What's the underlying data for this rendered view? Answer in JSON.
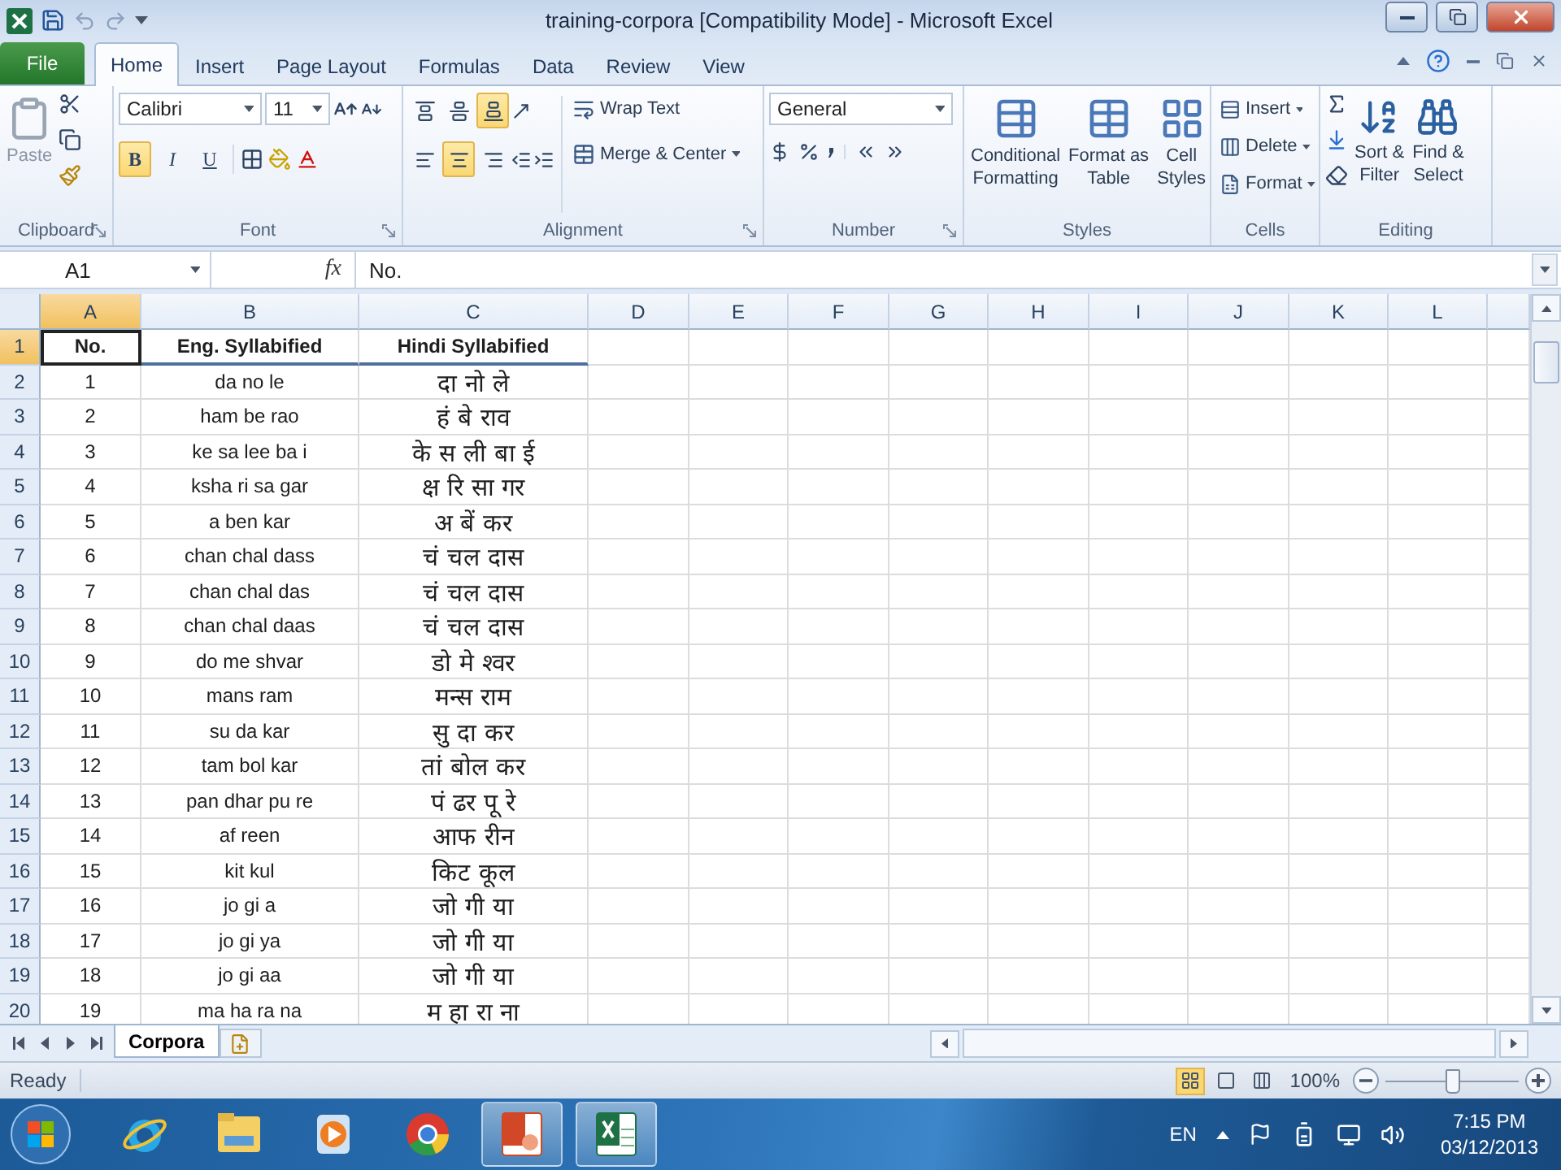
{
  "window": {
    "title": "training-corpora  [Compatibility Mode] - Microsoft Excel"
  },
  "ribbon_tabs": [
    {
      "label": "File",
      "kind": "file",
      "selected": false
    },
    {
      "label": "Home",
      "kind": "tab",
      "selected": true
    },
    {
      "label": "Insert",
      "kind": "tab",
      "selected": false
    },
    {
      "label": "Page Layout",
      "kind": "tab",
      "selected": false
    },
    {
      "label": "Formulas",
      "kind": "tab",
      "selected": false
    },
    {
      "label": "Data",
      "kind": "tab",
      "selected": false
    },
    {
      "label": "Review",
      "kind": "tab",
      "selected": false
    },
    {
      "label": "View",
      "kind": "tab",
      "selected": false
    }
  ],
  "clipboard": {
    "label": "Clipboard",
    "paste": "Paste"
  },
  "font": {
    "label": "Font",
    "name": "Calibri",
    "size": "11",
    "styles": [
      {
        "label": "B",
        "selected": true
      },
      {
        "label": "I",
        "selected": false
      },
      {
        "label": "U",
        "selected": false
      }
    ]
  },
  "alignment": {
    "label": "Alignment",
    "vertical": [
      {
        "selected": false
      },
      {
        "selected": false
      },
      {
        "selected": true
      }
    ],
    "horizontal": [
      {
        "selected": false
      },
      {
        "selected": true
      },
      {
        "selected": false
      }
    ],
    "wrap_text": "Wrap Text",
    "merge": "Merge & Center"
  },
  "number": {
    "label": "Number",
    "format": "General"
  },
  "styles": {
    "label": "Styles",
    "buttons": [
      {
        "lines": [
          "Conditional",
          "Formatting"
        ]
      },
      {
        "lines": [
          "Format as",
          "Table"
        ]
      },
      {
        "lines": [
          "Cell",
          "Styles"
        ]
      }
    ]
  },
  "cells": {
    "label": "Cells",
    "buttons": [
      "Insert",
      "Delete",
      "Format"
    ]
  },
  "editing": {
    "label": "Editing",
    "buttons": [
      {
        "lines": [
          "Sort &",
          "Filter"
        ]
      },
      {
        "lines": [
          "Find &",
          "Select"
        ]
      }
    ]
  },
  "formula_bar": {
    "name_box": "A1",
    "function_label": "fx",
    "value": "No."
  },
  "grid": {
    "columns": [
      {
        "label": "A",
        "selected": true
      },
      {
        "label": "B",
        "selected": false
      },
      {
        "label": "C",
        "selected": false
      },
      {
        "label": "D",
        "selected": false
      },
      {
        "label": "E",
        "selected": false
      },
      {
        "label": "F",
        "selected": false
      },
      {
        "label": "G",
        "selected": false
      },
      {
        "label": "H",
        "selected": false
      },
      {
        "label": "I",
        "selected": false
      },
      {
        "label": "J",
        "selected": false
      },
      {
        "label": "K",
        "selected": false
      },
      {
        "label": "L",
        "selected": false
      }
    ],
    "rows": [
      {
        "label": "1",
        "kind": "header",
        "selected": true,
        "cells": [
          "No.",
          "Eng. Syllabified",
          "Hindi Syllabified"
        ]
      },
      {
        "label": "2",
        "kind": "data",
        "selected": false,
        "cells": [
          "1",
          "da no le",
          "दा नो ले"
        ]
      },
      {
        "label": "3",
        "kind": "data",
        "selected": false,
        "cells": [
          "2",
          "ham be rao",
          "हं बे राव"
        ]
      },
      {
        "label": "4",
        "kind": "data",
        "selected": false,
        "cells": [
          "3",
          "ke sa lee ba i",
          "के स ली बा ई"
        ]
      },
      {
        "label": "5",
        "kind": "data",
        "selected": false,
        "cells": [
          "4",
          "ksha ri sa gar",
          "क्ष रि सा गर"
        ]
      },
      {
        "label": "6",
        "kind": "data",
        "selected": false,
        "cells": [
          "5",
          "a ben kar",
          "अ बें कर"
        ]
      },
      {
        "label": "7",
        "kind": "data",
        "selected": false,
        "cells": [
          "6",
          "chan chal dass",
          "चं चल दास"
        ]
      },
      {
        "label": "8",
        "kind": "data",
        "selected": false,
        "cells": [
          "7",
          "chan chal das",
          "चं चल दास"
        ]
      },
      {
        "label": "9",
        "kind": "data",
        "selected": false,
        "cells": [
          "8",
          "chan chal daas",
          "चं चल दास"
        ]
      },
      {
        "label": "10",
        "kind": "data",
        "selected": false,
        "cells": [
          "9",
          "do me shvar",
          "डो मे श्वर"
        ]
      },
      {
        "label": "11",
        "kind": "data",
        "selected": false,
        "cells": [
          "10",
          "mans ram",
          "मन्स राम"
        ]
      },
      {
        "label": "12",
        "kind": "data",
        "selected": false,
        "cells": [
          "11",
          "su da kar",
          "सु दा कर"
        ]
      },
      {
        "label": "13",
        "kind": "data",
        "selected": false,
        "cells": [
          "12",
          "tam bol kar",
          "तां बोल कर"
        ]
      },
      {
        "label": "14",
        "kind": "data",
        "selected": false,
        "cells": [
          "13",
          "pan dhar pu re",
          "पं ढर पू रे"
        ]
      },
      {
        "label": "15",
        "kind": "data",
        "selected": false,
        "cells": [
          "14",
          "af reen",
          "आफ रीन"
        ]
      },
      {
        "label": "16",
        "kind": "data",
        "selected": false,
        "cells": [
          "15",
          "kit kul",
          "किट कूल"
        ]
      },
      {
        "label": "17",
        "kind": "data",
        "selected": false,
        "cells": [
          "16",
          "jo gi a",
          "जो गी या"
        ]
      },
      {
        "label": "18",
        "kind": "data",
        "selected": false,
        "cells": [
          "17",
          "jo gi ya",
          "जो गी या"
        ]
      },
      {
        "label": "19",
        "kind": "data",
        "selected": false,
        "cells": [
          "18",
          "jo gi aa",
          "जो गी या"
        ]
      },
      {
        "label": "20",
        "kind": "data",
        "selected": false,
        "cells": [
          "19",
          "ma ha ra na",
          "म हा रा ना"
        ]
      }
    ]
  },
  "sheet_tabs": [
    {
      "label": "Corpora",
      "selected": true
    }
  ],
  "status_bar": {
    "status": "Ready",
    "views": [
      {
        "selected": true
      },
      {
        "selected": false
      },
      {
        "selected": false
      }
    ],
    "zoom": "100%",
    "zoom_slider": {
      "level": 0.5
    }
  },
  "taskbar": {
    "apps": [
      {
        "kind": "browser",
        "running": false
      },
      {
        "kind": "folder",
        "running": false
      },
      {
        "kind": "media",
        "running": false
      },
      {
        "kind": "chrome",
        "running": false
      },
      {
        "kind": "slides",
        "running": true
      },
      {
        "kind": "sheet",
        "running": true
      }
    ],
    "language": "EN",
    "time": "7:15 PM",
    "date": "03/12/2013"
  }
}
